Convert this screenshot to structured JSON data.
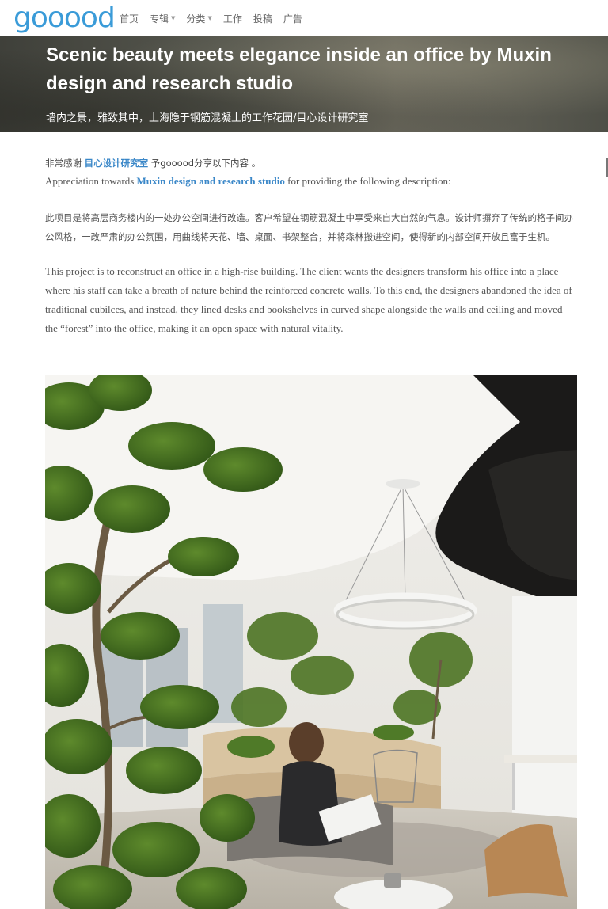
{
  "nav": {
    "logo": "gooood",
    "items": [
      {
        "label": "首页",
        "has_caret": false
      },
      {
        "label": "专辑",
        "has_caret": true
      },
      {
        "label": "分类",
        "has_caret": true
      },
      {
        "label": "工作",
        "has_caret": false
      },
      {
        "label": "投稿",
        "has_caret": false
      },
      {
        "label": "广告",
        "has_caret": false
      }
    ],
    "caret_glyph": "▼"
  },
  "hero": {
    "title": "Scenic beauty meets elegance inside an office by Muxin design and research studio",
    "subtitle": "墙内之景，雅致其中，上海隐于钢筋混凝土的工作花园/目心设计研究室"
  },
  "credit": {
    "cn_prefix": "非常感谢 ",
    "cn_link": "目心设计研究室",
    "cn_suffix": " 予gooood分享以下内容 。",
    "en_prefix": "Appreciation towards ",
    "en_link": "Muxin design and research studio",
    "en_suffix": " for providing the following description:"
  },
  "body": {
    "para_cn": "此项目是将高层商务楼内的一处办公空间进行改造。客户希望在钢筋混凝土中享受来自大自然的气息。设计师摒弃了传统的格子间办公风格，一改严肃的办公氛围，用曲线将天花、墙、桌面、书架整合，并将森林搬进空间，使得新的内部空间开放且富于生机。",
    "para_en": "This project is to reconstruct an office in a high-rise building. The client wants the designers transform his office into a place where his staff can take a breath of nature behind the reinforced concrete walls. To this end, the designers abandoned the idea of traditional cubilces, and instead, they lined desks and bookshelves in curved shape alongside the walls and ceiling and moved the “forest” into the office, making it an open space with natural vitality."
  },
  "colors": {
    "accent": "#3a9bd8",
    "link": "#3a87c8"
  }
}
